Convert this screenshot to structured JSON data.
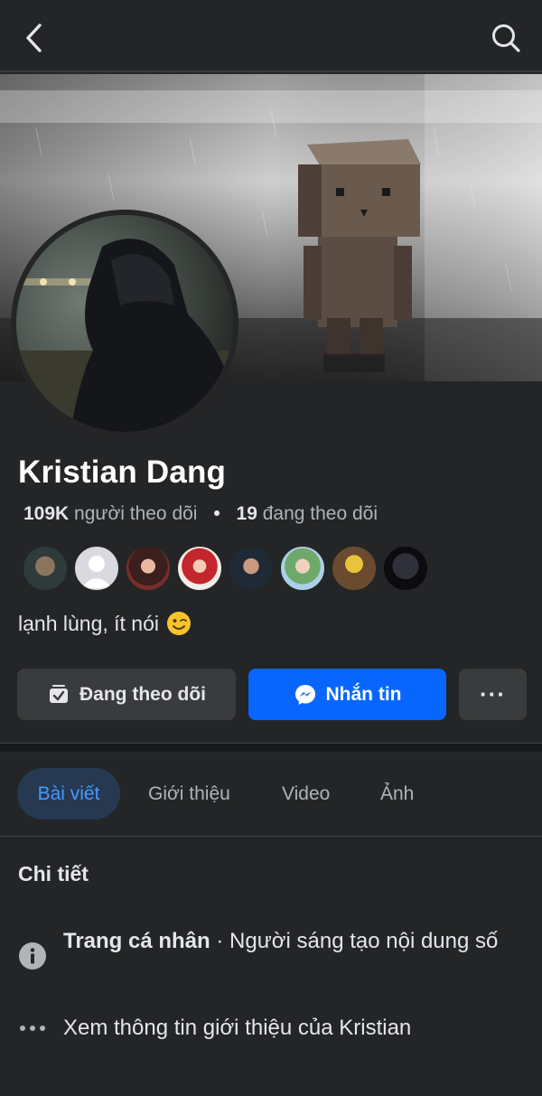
{
  "profile": {
    "name": "Kristian Dang",
    "followers_count": "109K",
    "followers_label": "người theo dõi",
    "separator": "•",
    "following_count": "19",
    "following_label": "đang theo dõi",
    "bio": "lạnh lùng, ít nói",
    "bio_emoji": "winking-face"
  },
  "actions": {
    "follow_label": "Đang theo dõi",
    "message_label": "Nhắn tin",
    "more_label": "···"
  },
  "tabs": [
    {
      "label": "Bài viết",
      "active": true
    },
    {
      "label": "Giới thiệu",
      "active": false
    },
    {
      "label": "Video",
      "active": false
    },
    {
      "label": "Ảnh",
      "active": false
    }
  ],
  "details": {
    "title": "Chi tiết",
    "page_type_bold": "Trang cá nhân",
    "page_type_rest": " · Người sáng tạo nội dung số",
    "see_more": "Xem thông tin giới thiệu của Kristian"
  },
  "colors": {
    "background": "#242526",
    "primary_button": "#0866ff",
    "active_tab_bg": "#263951",
    "active_tab_text": "#4599ff"
  }
}
